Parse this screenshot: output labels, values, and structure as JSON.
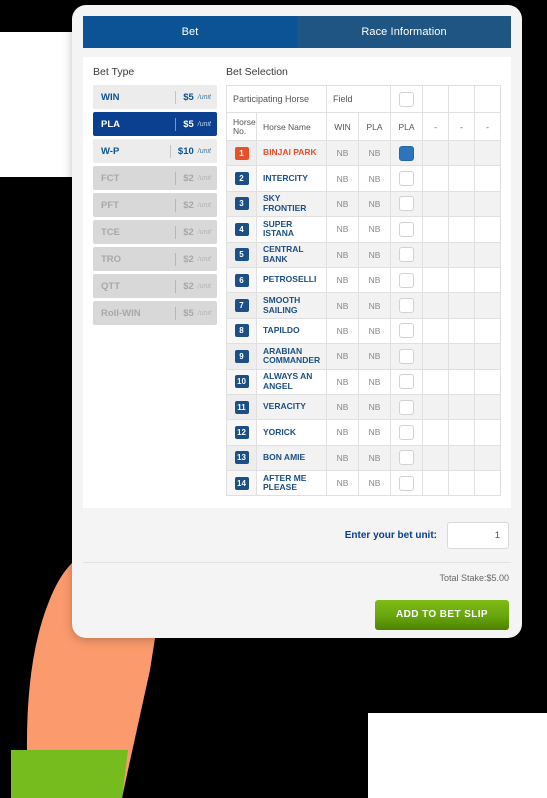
{
  "tabs": [
    {
      "label": "Bet",
      "active": true
    },
    {
      "label": "Race Information",
      "active": false
    }
  ],
  "bet_type": {
    "heading": "Bet Type",
    "unit_suffix": "/unit",
    "items": [
      {
        "code": "WIN",
        "price": "$5",
        "state": "enabled"
      },
      {
        "code": "PLA",
        "price": "$5",
        "state": "selected"
      },
      {
        "code": "W-P",
        "price": "$10",
        "state": "enabled"
      },
      {
        "code": "FCT",
        "price": "$2",
        "state": "disabled"
      },
      {
        "code": "PFT",
        "price": "$2",
        "state": "disabled"
      },
      {
        "code": "TCE",
        "price": "$2",
        "state": "disabled"
      },
      {
        "code": "TRO",
        "price": "$2",
        "state": "disabled"
      },
      {
        "code": "QTT",
        "price": "$2",
        "state": "disabled"
      },
      {
        "code": "Roll-WIN",
        "price": "$5",
        "state": "disabled"
      }
    ]
  },
  "bet_selection": {
    "heading": "Bet Selection",
    "group_headers": {
      "participating_horse": "Participating Horse",
      "field": "Field",
      "field_checkbox_checked": false
    },
    "columns": {
      "horse_no": "Horse No.",
      "horse_name": "Horse Name",
      "win": "WIN",
      "pla": "PLA",
      "pla_select": "PLA",
      "extra1": "-",
      "extra2": "-",
      "extra3": "-"
    },
    "rows": [
      {
        "no": "1",
        "name": "BINJAI PARK",
        "win": "NB",
        "pla": "NB",
        "checked": true,
        "highlight": true
      },
      {
        "no": "2",
        "name": "INTERCITY",
        "win": "NB",
        "pla": "NB",
        "checked": false,
        "highlight": false
      },
      {
        "no": "3",
        "name": "SKY FRONTIER",
        "win": "NB",
        "pla": "NB",
        "checked": false,
        "highlight": false
      },
      {
        "no": "4",
        "name": "SUPER ISTANA",
        "win": "NB",
        "pla": "NB",
        "checked": false,
        "highlight": false
      },
      {
        "no": "5",
        "name": "CENTRAL BANK",
        "win": "NB",
        "pla": "NB",
        "checked": false,
        "highlight": false
      },
      {
        "no": "6",
        "name": "PETROSELLI",
        "win": "NB",
        "pla": "NB",
        "checked": false,
        "highlight": false
      },
      {
        "no": "7",
        "name": "SMOOTH SAILING",
        "win": "NB",
        "pla": "NB",
        "checked": false,
        "highlight": false
      },
      {
        "no": "8",
        "name": "TAPILDO",
        "win": "NB",
        "pla": "NB",
        "checked": false,
        "highlight": false
      },
      {
        "no": "9",
        "name": "ARABIAN COMMANDER",
        "win": "NB",
        "pla": "NB",
        "checked": false,
        "highlight": false
      },
      {
        "no": "10",
        "name": "ALWAYS AN ANGEL",
        "win": "NB",
        "pla": "NB",
        "checked": false,
        "highlight": false
      },
      {
        "no": "11",
        "name": "VERACITY",
        "win": "NB",
        "pla": "NB",
        "checked": false,
        "highlight": false
      },
      {
        "no": "12",
        "name": "YORICK",
        "win": "NB",
        "pla": "NB",
        "checked": false,
        "highlight": false
      },
      {
        "no": "13",
        "name": "BON AMIE",
        "win": "NB",
        "pla": "NB",
        "checked": false,
        "highlight": false
      },
      {
        "no": "14",
        "name": "AFTER ME PLEASE",
        "win": "NB",
        "pla": "NB",
        "checked": false,
        "highlight": false
      }
    ]
  },
  "footer": {
    "unit_label": "Enter your bet unit:",
    "unit_value": "1",
    "unit_placeholder": "1",
    "total_stake": "Total Stake:$5.00",
    "submit_label": "ADD TO BET SLIP"
  },
  "colors": {
    "tab_active": "#0b5394",
    "tab_inactive": "#1f5582",
    "selected_bet": "#0b3f8f",
    "highlight_horse": "#e8502a",
    "badge_navy": "#1b4f85",
    "checkbox_checked": "#2d74bd",
    "submit_green": "#67a50d",
    "hand_skin": "#fb9b6d",
    "hand_sleeve": "#77bc1f"
  }
}
